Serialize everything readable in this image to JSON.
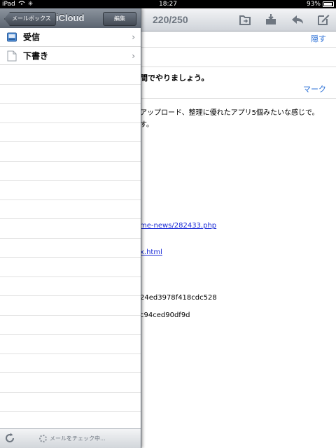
{
  "status_bar": {
    "device": "iPad",
    "time": "18:27",
    "battery": "93%"
  },
  "toolbar": {
    "counter": "220/250"
  },
  "email": {
    "hide_label": "隠す",
    "subject_fragment": "間でやりましょう。",
    "mark_label": "マーク",
    "body_lines": [
      "アップロード、整理に優れたアプリ5個みたいな感じで。",
      "す。",
      "me-news/282433.php",
      "x.html",
      "24ed3978f418cdc528",
      "c94ced90df9d"
    ]
  },
  "popover": {
    "back_label": "メールボックス",
    "title": "iCloud",
    "edit_label": "編集",
    "mailboxes": [
      {
        "label": "受信",
        "icon": "inbox-icon"
      },
      {
        "label": "下書き",
        "icon": "drafts-icon"
      }
    ],
    "footer_status": "メールをチェック中..."
  },
  "colors": {
    "link": "#2a6fd6",
    "popover_header": "#5b6470"
  }
}
